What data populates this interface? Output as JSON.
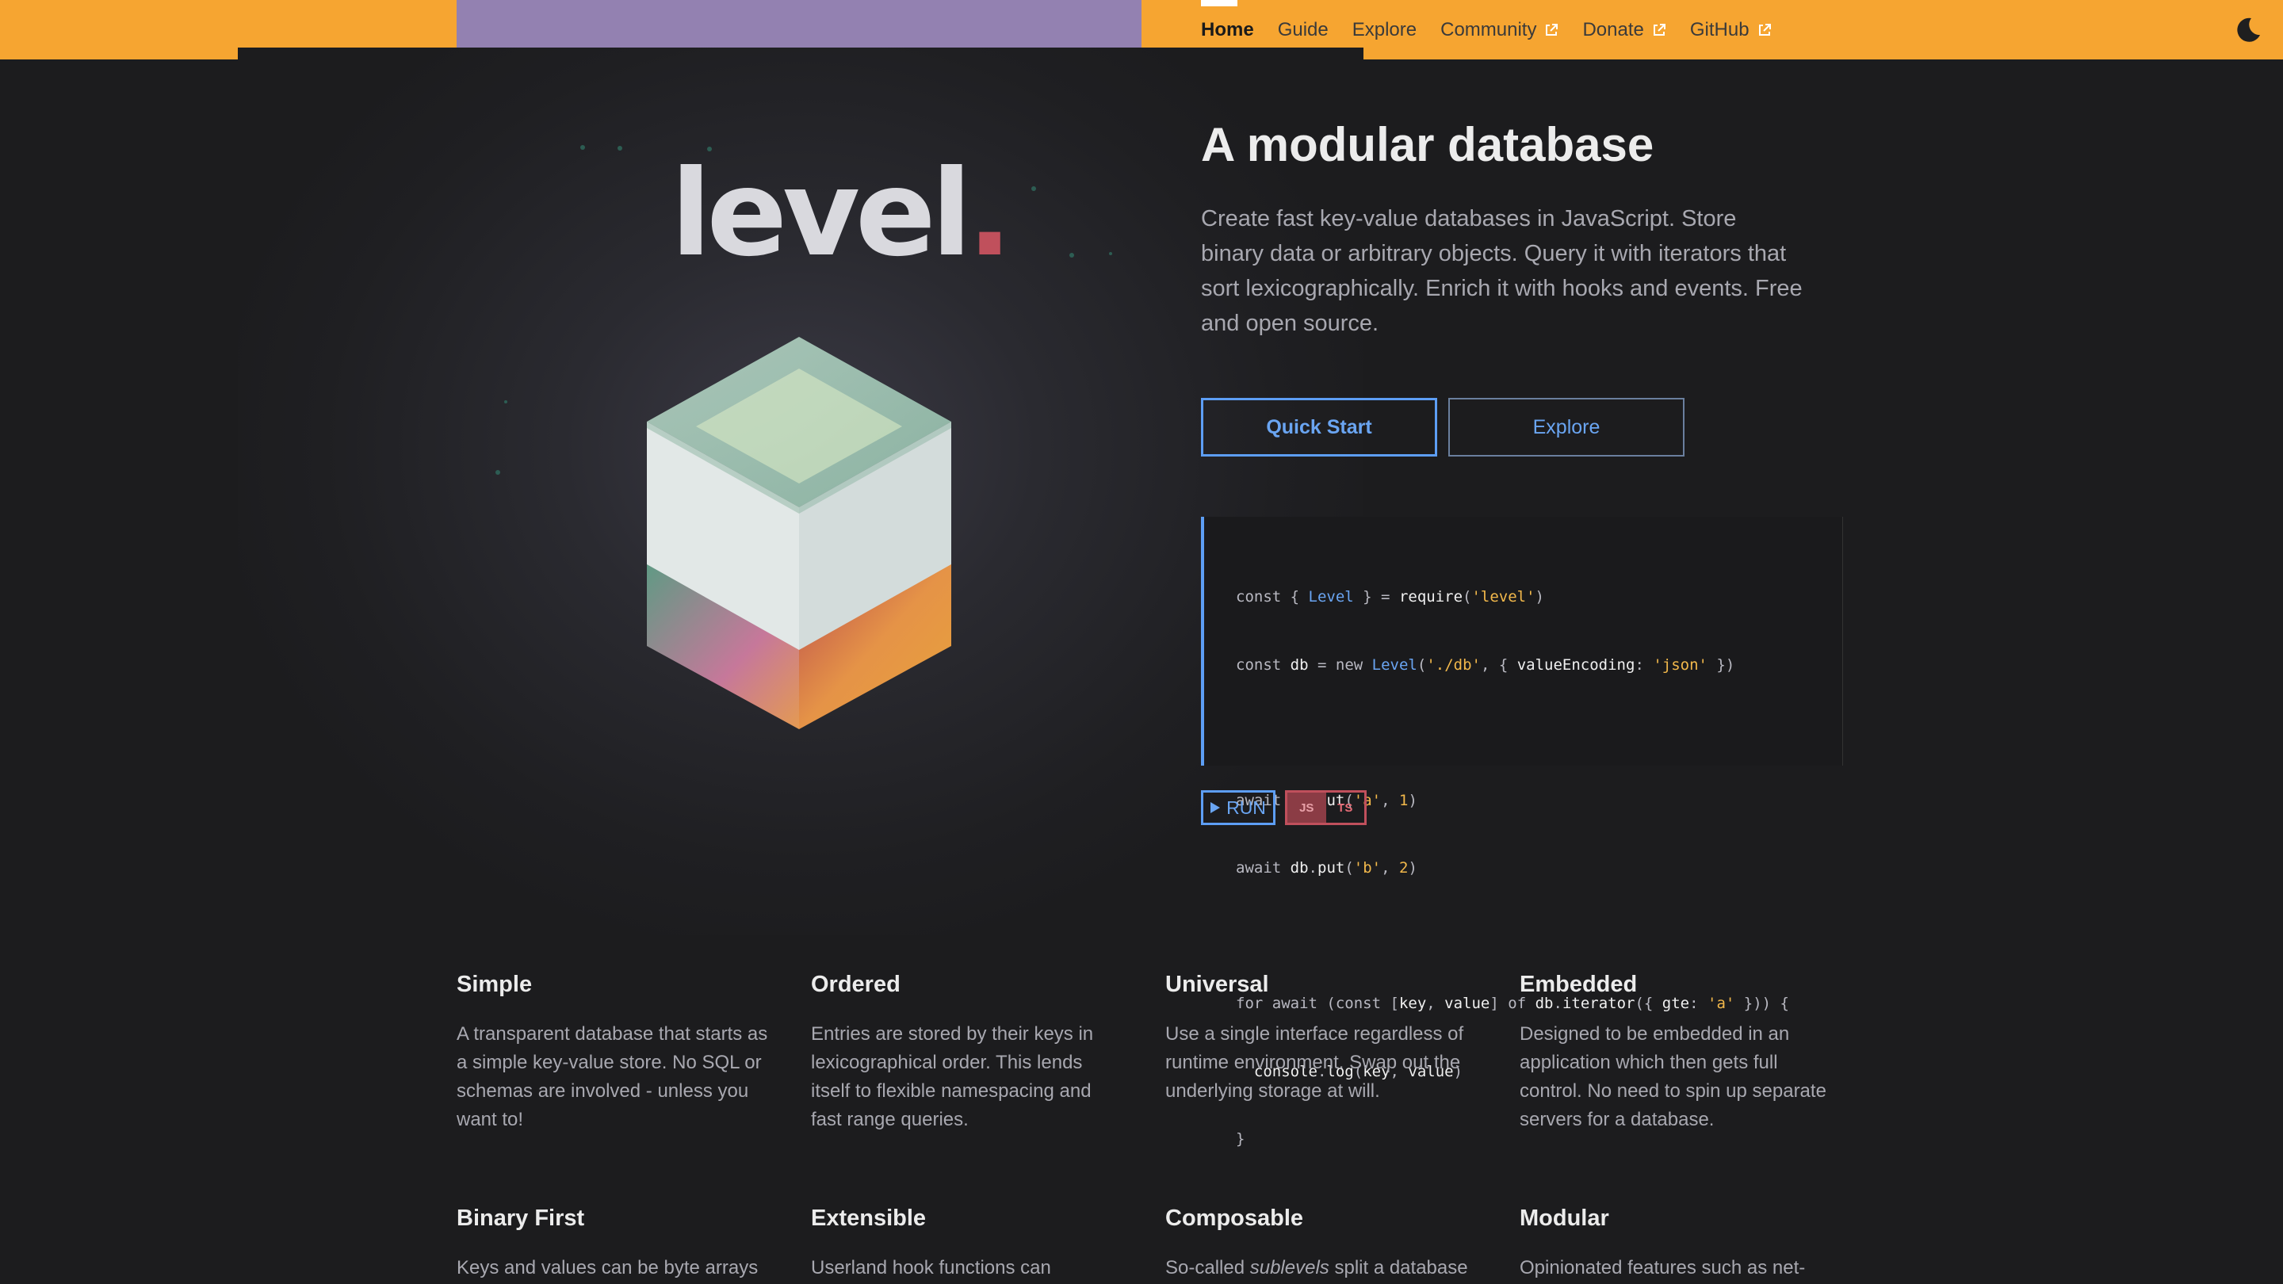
{
  "nav": {
    "items": [
      {
        "label": "Home",
        "active": true,
        "external": false
      },
      {
        "label": "Guide",
        "active": false,
        "external": false
      },
      {
        "label": "Explore",
        "active": false,
        "external": false
      },
      {
        "label": "Community",
        "active": false,
        "external": true
      },
      {
        "label": "Donate",
        "active": false,
        "external": true
      },
      {
        "label": "GitHub",
        "active": false,
        "external": true
      }
    ],
    "theme_icon": "moon-icon"
  },
  "hero": {
    "wordmark": "level",
    "wordmark_dot": ".",
    "title": "A modular database",
    "description": "Create fast key-value databases in JavaScript. Store binary data or arbitrary objects. Query it with iterators that sort lexicographically. Enrich it with hooks and events. Free and open source.",
    "primary_button": "Quick Start",
    "secondary_button": "Explore"
  },
  "code": {
    "lines": [
      "const { Level } = require('level')",
      "const db = new Level('./db', { valueEncoding: 'json' })",
      "",
      "await db.put('a', 1)",
      "await db.put('b', 2)",
      "",
      "for await (const [key, value] of db.iterator({ gte: 'a' })) {",
      "  console.log(key, value)",
      "}"
    ],
    "run_label": "RUN",
    "languages": [
      "JS",
      "TS"
    ],
    "selected_language": "JS"
  },
  "features": [
    {
      "title": "Simple",
      "text": "A transparent database that starts as a simple key-value store. No SQL or schemas are involved - unless you want to!"
    },
    {
      "title": "Ordered",
      "text": "Entries are stored by their keys in lexicographical order. This lends itself to flexible namespacing and fast range queries."
    },
    {
      "title": "Universal",
      "text": "Use a single interface regardless of runtime environment. Swap out the underlying storage at will."
    },
    {
      "title": "Embedded",
      "text": "Designed to be embedded in an application which then gets full control. No need to spin up separate servers for a database."
    },
    {
      "title": "Binary First",
      "text": "Keys and values can be byte arrays"
    },
    {
      "title": "Extensible",
      "text": "Userland hook functions can"
    },
    {
      "title": "Composable",
      "text_before": "So-called ",
      "text_em": "sublevels",
      "text_after": " split a database"
    },
    {
      "title": "Modular",
      "text": "Opinionated features such as net-"
    }
  ],
  "colors": {
    "topbar": "#f6a531",
    "topbar_accent": "#9381b1",
    "background": "#1c1c1e",
    "accent_blue": "#5d9ef5",
    "accent_red": "#c0505c"
  }
}
